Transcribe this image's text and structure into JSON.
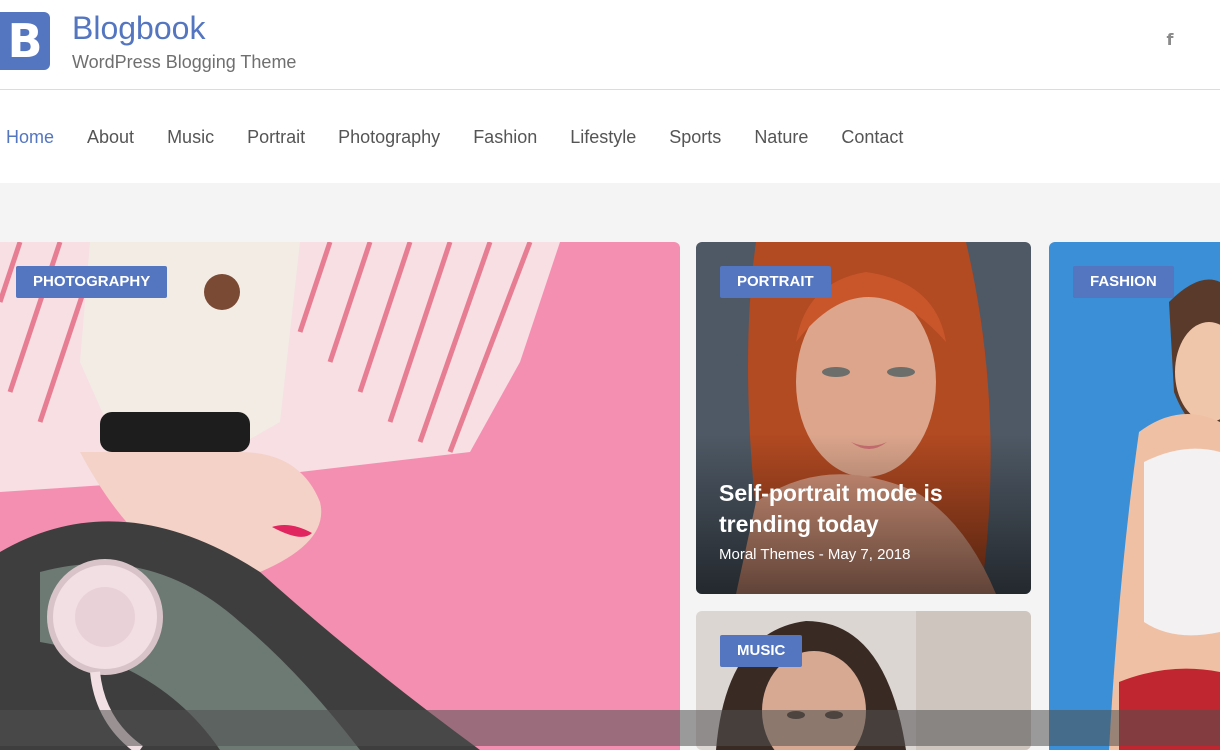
{
  "site": {
    "logo_letter": "B",
    "title": "Blogbook",
    "tagline": "WordPress Blogging Theme",
    "social_icon": "f"
  },
  "nav": {
    "items": [
      {
        "label": "Home",
        "active": true
      },
      {
        "label": "About"
      },
      {
        "label": "Music"
      },
      {
        "label": "Portrait"
      },
      {
        "label": "Photography"
      },
      {
        "label": "Fashion"
      },
      {
        "label": "Lifestyle"
      },
      {
        "label": "Sports"
      },
      {
        "label": "Nature"
      },
      {
        "label": "Contact"
      }
    ]
  },
  "featured": [
    {
      "category": "PHOTOGRAPHY"
    },
    {
      "category": "PORTRAIT",
      "title": "Self-portrait mode is trending today",
      "meta": "Moral Themes - May 7, 2018"
    },
    {
      "category": "MUSIC"
    },
    {
      "category": "FASHION"
    }
  ],
  "colors": {
    "accent": "#5475c0",
    "nav_text": "#555555",
    "tagline": "#6f6f6f"
  }
}
